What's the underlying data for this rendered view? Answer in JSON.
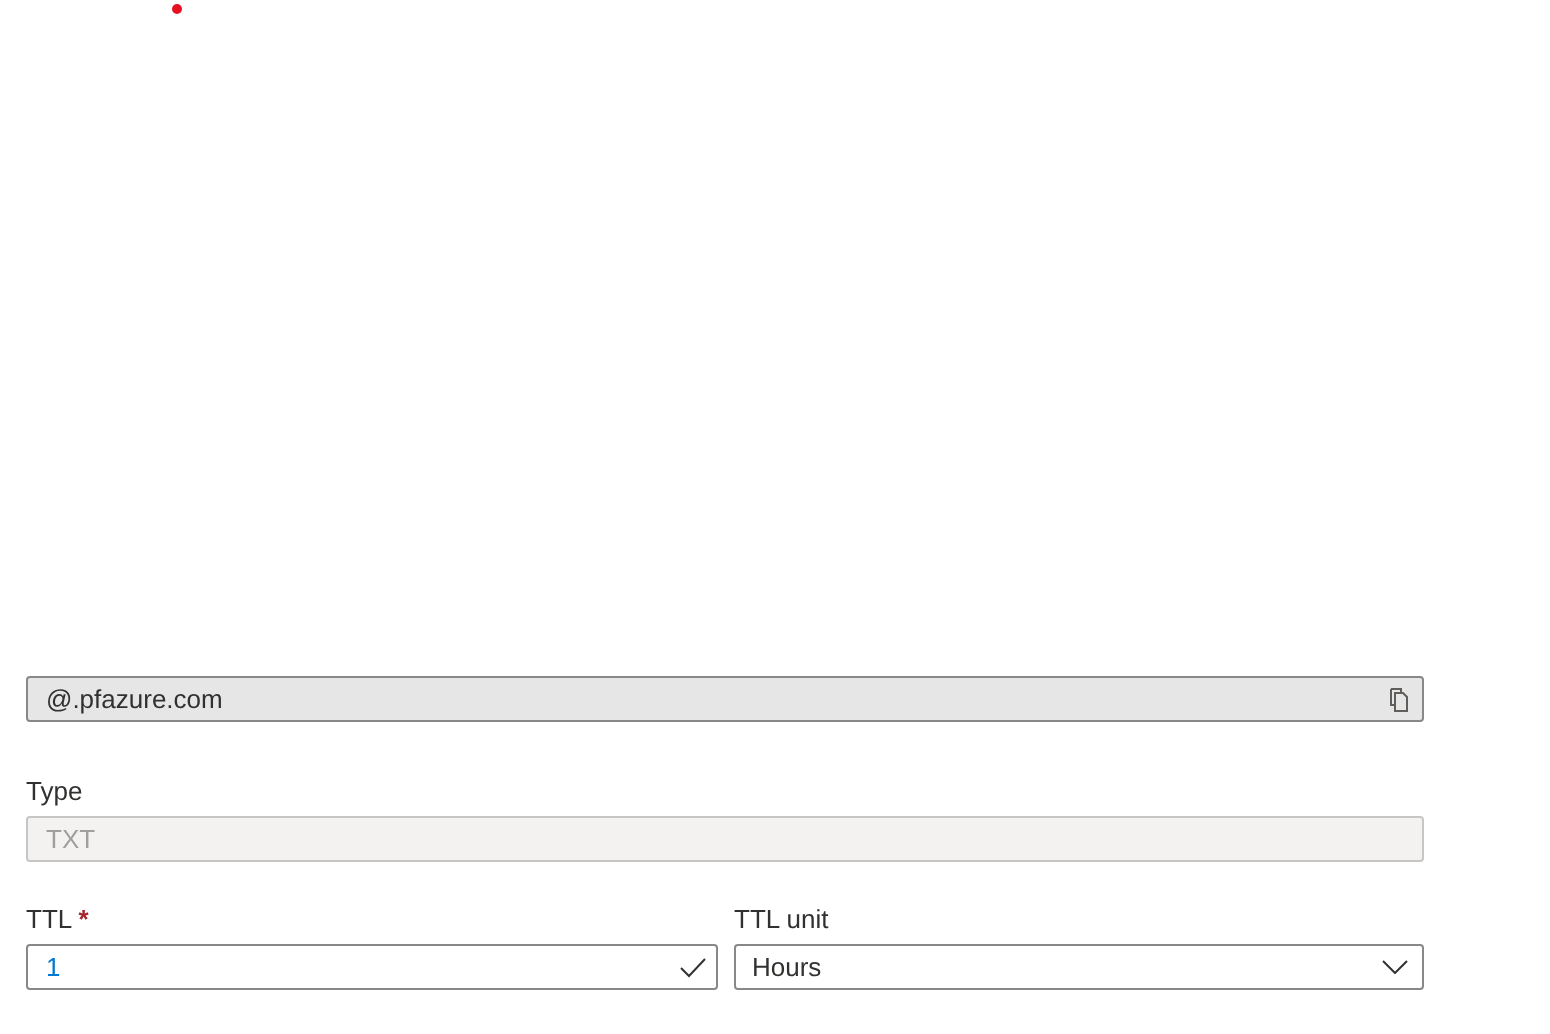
{
  "record_name": {
    "value": "@.pfazure.com",
    "copyable": true
  },
  "type_field": {
    "label": "Type",
    "value": "TXT",
    "disabled": true
  },
  "ttl": {
    "label": "TTL",
    "required_mark": "*",
    "value": "1",
    "valid": true
  },
  "ttl_unit": {
    "label": "TTL unit",
    "value": "Hours"
  }
}
